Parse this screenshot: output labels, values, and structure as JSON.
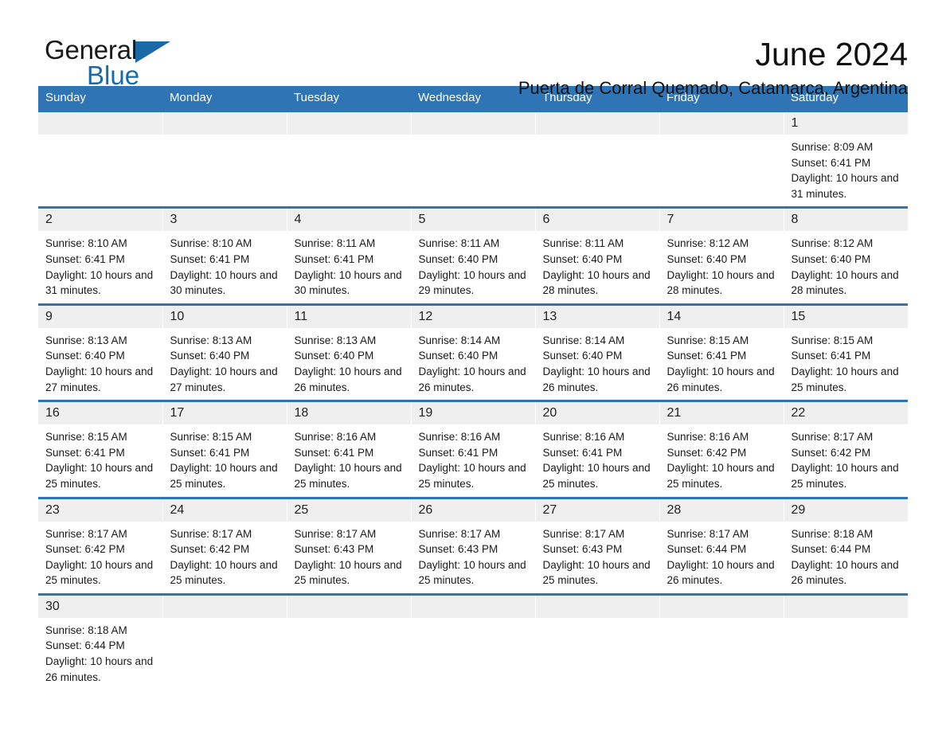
{
  "brand": {
    "name_part1": "General",
    "name_part2": "Blue",
    "accent_color": "#1a6aa8",
    "triangle_icon": "logo-triangle-icon"
  },
  "header": {
    "title": "June 2024",
    "subtitle": "Puerta de Corral Quemado, Catamarca, Argentina"
  },
  "theme": {
    "header_bg": "#2f75b5",
    "daynum_bg": "#efefef",
    "text": "#1a1a1a"
  },
  "weekday_headers": [
    "Sunday",
    "Monday",
    "Tuesday",
    "Wednesday",
    "Thursday",
    "Friday",
    "Saturday"
  ],
  "weeks": [
    [
      {
        "day": "",
        "empty": true
      },
      {
        "day": "",
        "empty": true
      },
      {
        "day": "",
        "empty": true
      },
      {
        "day": "",
        "empty": true
      },
      {
        "day": "",
        "empty": true
      },
      {
        "day": "",
        "empty": true
      },
      {
        "day": "1",
        "sunrise": "Sunrise: 8:09 AM",
        "sunset": "Sunset: 6:41 PM",
        "daylight": "Daylight: 10 hours and 31 minutes."
      }
    ],
    [
      {
        "day": "2",
        "sunrise": "Sunrise: 8:10 AM",
        "sunset": "Sunset: 6:41 PM",
        "daylight": "Daylight: 10 hours and 31 minutes."
      },
      {
        "day": "3",
        "sunrise": "Sunrise: 8:10 AM",
        "sunset": "Sunset: 6:41 PM",
        "daylight": "Daylight: 10 hours and 30 minutes."
      },
      {
        "day": "4",
        "sunrise": "Sunrise: 8:11 AM",
        "sunset": "Sunset: 6:41 PM",
        "daylight": "Daylight: 10 hours and 30 minutes."
      },
      {
        "day": "5",
        "sunrise": "Sunrise: 8:11 AM",
        "sunset": "Sunset: 6:40 PM",
        "daylight": "Daylight: 10 hours and 29 minutes."
      },
      {
        "day": "6",
        "sunrise": "Sunrise: 8:11 AM",
        "sunset": "Sunset: 6:40 PM",
        "daylight": "Daylight: 10 hours and 28 minutes."
      },
      {
        "day": "7",
        "sunrise": "Sunrise: 8:12 AM",
        "sunset": "Sunset: 6:40 PM",
        "daylight": "Daylight: 10 hours and 28 minutes."
      },
      {
        "day": "8",
        "sunrise": "Sunrise: 8:12 AM",
        "sunset": "Sunset: 6:40 PM",
        "daylight": "Daylight: 10 hours and 28 minutes."
      }
    ],
    [
      {
        "day": "9",
        "sunrise": "Sunrise: 8:13 AM",
        "sunset": "Sunset: 6:40 PM",
        "daylight": "Daylight: 10 hours and 27 minutes."
      },
      {
        "day": "10",
        "sunrise": "Sunrise: 8:13 AM",
        "sunset": "Sunset: 6:40 PM",
        "daylight": "Daylight: 10 hours and 27 minutes."
      },
      {
        "day": "11",
        "sunrise": "Sunrise: 8:13 AM",
        "sunset": "Sunset: 6:40 PM",
        "daylight": "Daylight: 10 hours and 26 minutes."
      },
      {
        "day": "12",
        "sunrise": "Sunrise: 8:14 AM",
        "sunset": "Sunset: 6:40 PM",
        "daylight": "Daylight: 10 hours and 26 minutes."
      },
      {
        "day": "13",
        "sunrise": "Sunrise: 8:14 AM",
        "sunset": "Sunset: 6:40 PM",
        "daylight": "Daylight: 10 hours and 26 minutes."
      },
      {
        "day": "14",
        "sunrise": "Sunrise: 8:15 AM",
        "sunset": "Sunset: 6:41 PM",
        "daylight": "Daylight: 10 hours and 26 minutes."
      },
      {
        "day": "15",
        "sunrise": "Sunrise: 8:15 AM",
        "sunset": "Sunset: 6:41 PM",
        "daylight": "Daylight: 10 hours and 25 minutes."
      }
    ],
    [
      {
        "day": "16",
        "sunrise": "Sunrise: 8:15 AM",
        "sunset": "Sunset: 6:41 PM",
        "daylight": "Daylight: 10 hours and 25 minutes."
      },
      {
        "day": "17",
        "sunrise": "Sunrise: 8:15 AM",
        "sunset": "Sunset: 6:41 PM",
        "daylight": "Daylight: 10 hours and 25 minutes."
      },
      {
        "day": "18",
        "sunrise": "Sunrise: 8:16 AM",
        "sunset": "Sunset: 6:41 PM",
        "daylight": "Daylight: 10 hours and 25 minutes."
      },
      {
        "day": "19",
        "sunrise": "Sunrise: 8:16 AM",
        "sunset": "Sunset: 6:41 PM",
        "daylight": "Daylight: 10 hours and 25 minutes."
      },
      {
        "day": "20",
        "sunrise": "Sunrise: 8:16 AM",
        "sunset": "Sunset: 6:41 PM",
        "daylight": "Daylight: 10 hours and 25 minutes."
      },
      {
        "day": "21",
        "sunrise": "Sunrise: 8:16 AM",
        "sunset": "Sunset: 6:42 PM",
        "daylight": "Daylight: 10 hours and 25 minutes."
      },
      {
        "day": "22",
        "sunrise": "Sunrise: 8:17 AM",
        "sunset": "Sunset: 6:42 PM",
        "daylight": "Daylight: 10 hours and 25 minutes."
      }
    ],
    [
      {
        "day": "23",
        "sunrise": "Sunrise: 8:17 AM",
        "sunset": "Sunset: 6:42 PM",
        "daylight": "Daylight: 10 hours and 25 minutes."
      },
      {
        "day": "24",
        "sunrise": "Sunrise: 8:17 AM",
        "sunset": "Sunset: 6:42 PM",
        "daylight": "Daylight: 10 hours and 25 minutes."
      },
      {
        "day": "25",
        "sunrise": "Sunrise: 8:17 AM",
        "sunset": "Sunset: 6:43 PM",
        "daylight": "Daylight: 10 hours and 25 minutes."
      },
      {
        "day": "26",
        "sunrise": "Sunrise: 8:17 AM",
        "sunset": "Sunset: 6:43 PM",
        "daylight": "Daylight: 10 hours and 25 minutes."
      },
      {
        "day": "27",
        "sunrise": "Sunrise: 8:17 AM",
        "sunset": "Sunset: 6:43 PM",
        "daylight": "Daylight: 10 hours and 25 minutes."
      },
      {
        "day": "28",
        "sunrise": "Sunrise: 8:17 AM",
        "sunset": "Sunset: 6:44 PM",
        "daylight": "Daylight: 10 hours and 26 minutes."
      },
      {
        "day": "29",
        "sunrise": "Sunrise: 8:18 AM",
        "sunset": "Sunset: 6:44 PM",
        "daylight": "Daylight: 10 hours and 26 minutes."
      }
    ],
    [
      {
        "day": "30",
        "sunrise": "Sunrise: 8:18 AM",
        "sunset": "Sunset: 6:44 PM",
        "daylight": "Daylight: 10 hours and 26 minutes."
      },
      {
        "day": "",
        "empty": true
      },
      {
        "day": "",
        "empty": true
      },
      {
        "day": "",
        "empty": true
      },
      {
        "day": "",
        "empty": true
      },
      {
        "day": "",
        "empty": true
      },
      {
        "day": "",
        "empty": true
      }
    ]
  ]
}
